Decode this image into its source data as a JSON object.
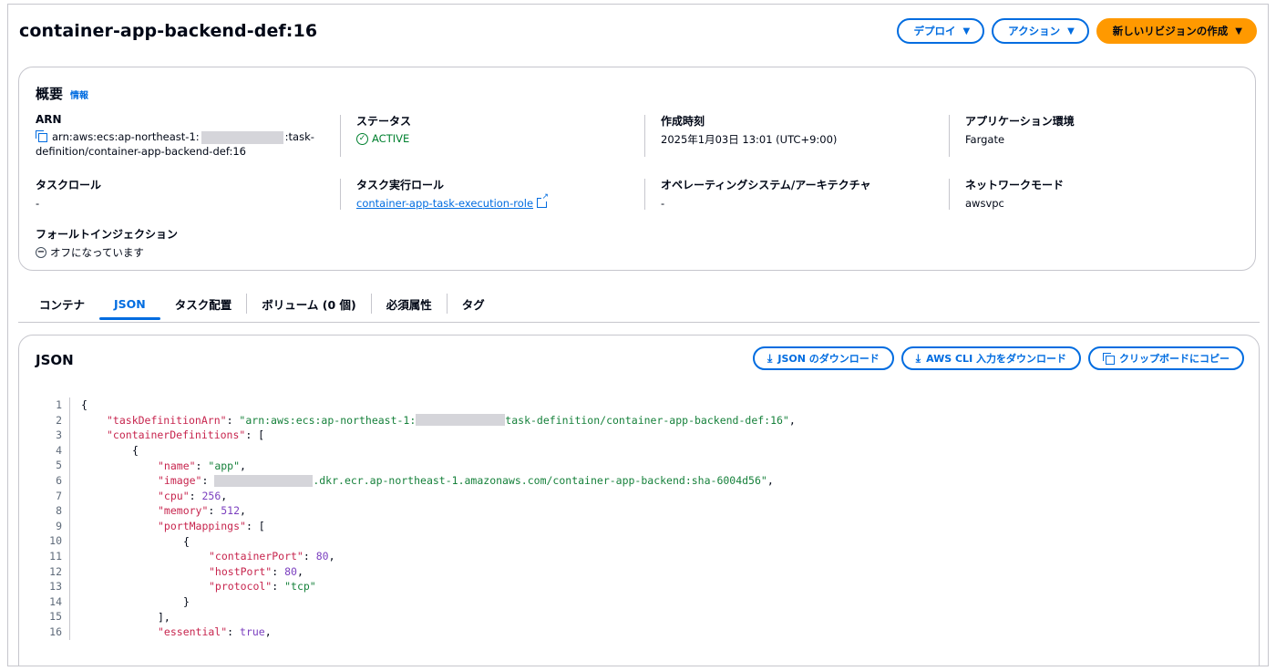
{
  "header": {
    "title": "container-app-backend-def:16",
    "deploy_label": "デプロイ",
    "actions_label": "アクション",
    "new_revision_label": "新しいリビジョンの作成"
  },
  "overview": {
    "title": "概要",
    "info_label": "情報",
    "arn_label": "ARN",
    "arn_prefix": "arn:aws:ecs:ap-northeast-1:",
    "arn_suffix": ":task-",
    "arn_line2": "definition/container-app-backend-def:16",
    "status_label": "ステータス",
    "status_value": "ACTIVE",
    "created_label": "作成時刻",
    "created_value": "2025年1月03日 13:01 (UTC+9:00)",
    "app_env_label": "アプリケーション環境",
    "app_env_value": "Fargate",
    "task_role_label": "タスクロール",
    "task_role_value": "-",
    "exec_role_label": "タスク実行ロール",
    "exec_role_value": "container-app-task-execution-role",
    "os_label": "オペレーティングシステム/アーキテクチャ",
    "os_value": "-",
    "network_label": "ネットワークモード",
    "network_value": "awsvpc",
    "fault_label": "フォールトインジェクション",
    "fault_value": "オフになっています"
  },
  "tabs": [
    {
      "label": "コンテナ"
    },
    {
      "label": "JSON"
    },
    {
      "label": "タスク配置"
    },
    {
      "label": "ボリューム (0 個)"
    },
    {
      "label": "必須属性"
    },
    {
      "label": "タグ"
    }
  ],
  "json_panel": {
    "title": "JSON",
    "download_json_label": "JSON のダウンロード",
    "download_cli_label": "AWS CLI 入力をダウンロード",
    "copy_label": "クリップボードにコピー"
  },
  "code": {
    "line_numbers": [
      "1",
      "2",
      "3",
      "4",
      "5",
      "6",
      "7",
      "8",
      "9",
      "10",
      "11",
      "12",
      "13",
      "14",
      "15",
      "16"
    ],
    "open_brace": "{",
    "k_taskDefinitionArn": "\"taskDefinitionArn\"",
    "v_arn_prefix": "\"arn:aws:ecs:ap-northeast-1:",
    "v_arn_suffix": "task-definition/container-app-backend-def:16\"",
    "k_containerDefinitions": "\"containerDefinitions\"",
    "k_name": "\"name\"",
    "v_name": "\"app\"",
    "k_image": "\"image\"",
    "v_image_suffix": ".dkr.ecr.ap-northeast-1.amazonaws.com/container-app-backend:sha-6004d56\"",
    "k_cpu": "\"cpu\"",
    "v_cpu": "256",
    "k_memory": "\"memory\"",
    "v_memory": "512",
    "k_portMappings": "\"portMappings\"",
    "k_containerPort": "\"containerPort\"",
    "v_containerPort": "80",
    "k_hostPort": "\"hostPort\"",
    "v_hostPort": "80",
    "k_protocol": "\"protocol\"",
    "v_protocol": "\"tcp\"",
    "k_essential": "\"essential\"",
    "v_essential": "true"
  },
  "colors": {
    "accent": "#006ce0",
    "primary_button": "#ff9900",
    "status_active": "#00802f"
  }
}
